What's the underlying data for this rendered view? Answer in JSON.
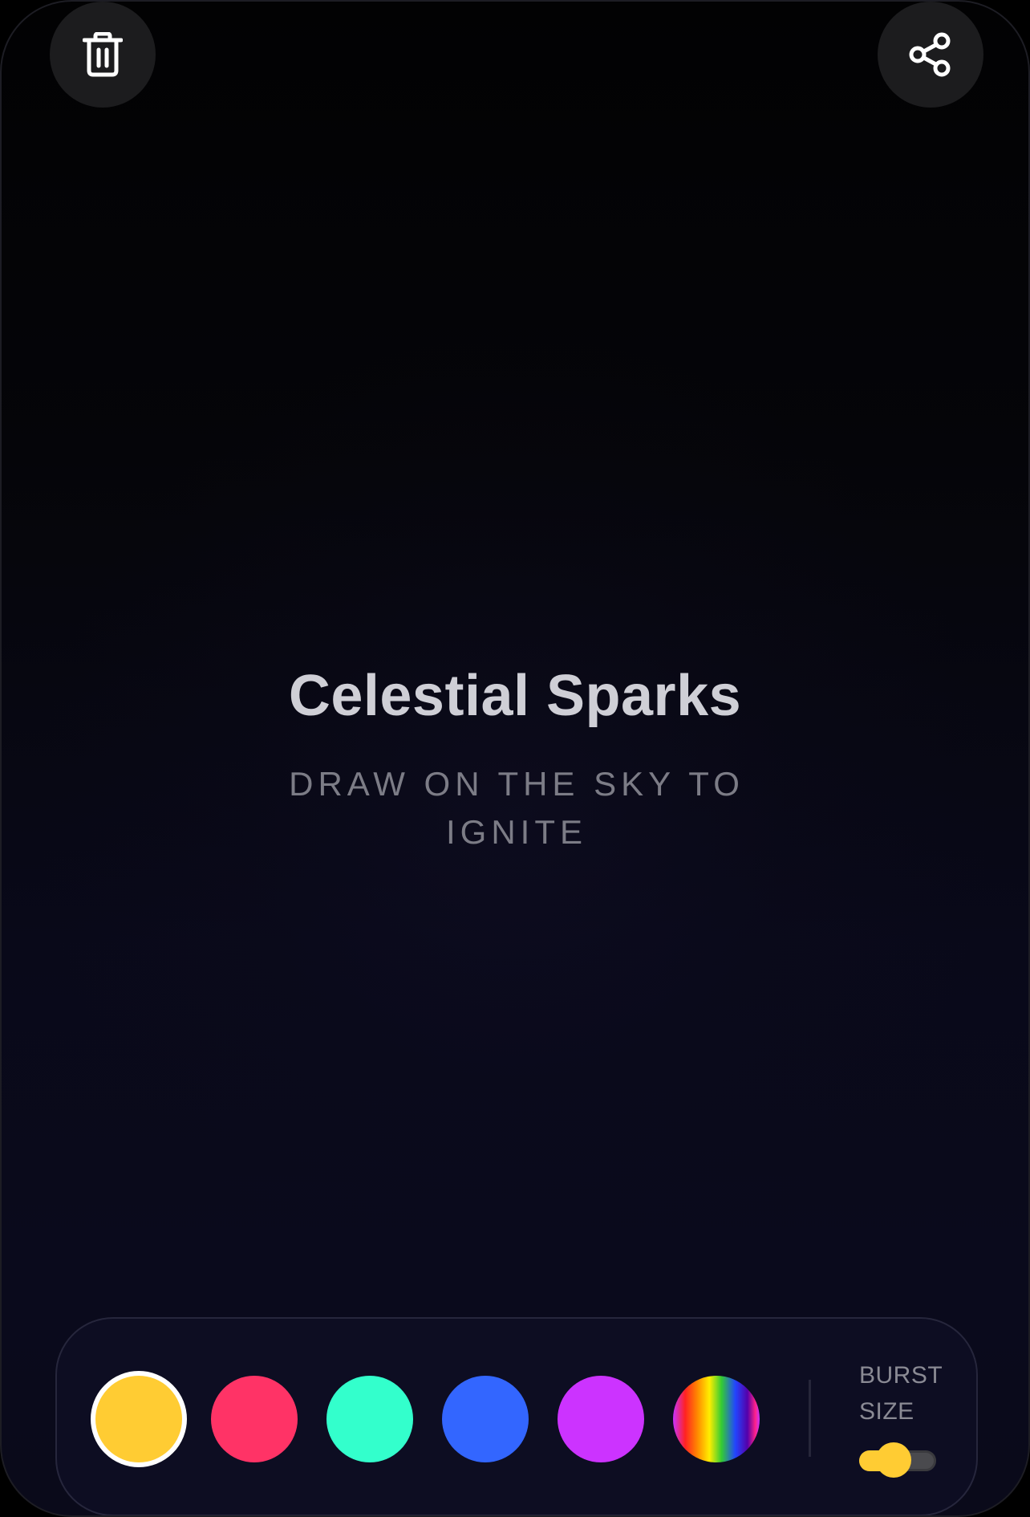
{
  "header": {
    "clear_icon": "trash-icon",
    "share_icon": "share-icon"
  },
  "main": {
    "title": "Celestial Sparks",
    "subtitle": "DRAW ON THE SKY TO IGNITE"
  },
  "palette": {
    "selected_index": 0,
    "swatches": [
      {
        "name": "yellow",
        "color": "#ffcc33"
      },
      {
        "name": "red",
        "color": "#ff3366"
      },
      {
        "name": "teal",
        "color": "#33ffcc"
      },
      {
        "name": "blue",
        "color": "#3366ff"
      },
      {
        "name": "purple",
        "color": "#cc33ff"
      },
      {
        "name": "rainbow",
        "color": "rainbow"
      }
    ]
  },
  "burst": {
    "label": "BURST SIZE",
    "value": 0.45,
    "accent": "#ffcc33"
  }
}
